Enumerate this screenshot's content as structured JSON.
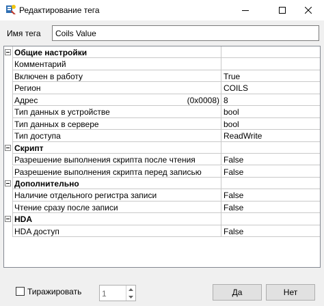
{
  "window": {
    "title": "Редактирование тега",
    "icon": "app-icon",
    "controls": [
      "minimize-icon",
      "maximize-icon",
      "close-icon"
    ]
  },
  "tag_name": {
    "label": "Имя тега",
    "value": "Coils Value"
  },
  "grid": {
    "rows": [
      {
        "type": "category",
        "name": "Общие настройки",
        "value": ""
      },
      {
        "type": "property",
        "name": "Комментарий",
        "value": ""
      },
      {
        "type": "property",
        "name": "Включен в работу",
        "value": "True"
      },
      {
        "type": "property",
        "name": "Регион",
        "value": "COILS"
      },
      {
        "type": "property",
        "name": "Адрес",
        "extra": "(0x0008)",
        "value": "8"
      },
      {
        "type": "property",
        "name": "Тип данных в устройстве",
        "value": "bool"
      },
      {
        "type": "property",
        "name": "Тип данных в сервере",
        "value": "bool"
      },
      {
        "type": "property",
        "name": "Тип доступа",
        "value": "ReadWrite"
      },
      {
        "type": "category",
        "name": "Скрипт",
        "value": ""
      },
      {
        "type": "property",
        "name": "Разрешение выполнения скрипта после чтения",
        "value": "False"
      },
      {
        "type": "property",
        "name": "Разрешение выполнения скрипта перед записью",
        "value": "False"
      },
      {
        "type": "category",
        "name": "Дополнительно",
        "value": ""
      },
      {
        "type": "property",
        "name": "Наличие отдельного регистра записи",
        "value": "False"
      },
      {
        "type": "property",
        "name": "Чтение сразу после записи",
        "value": "False"
      },
      {
        "type": "category",
        "name": "HDA",
        "value": ""
      },
      {
        "type": "property",
        "name": "HDA доступ",
        "value": "False"
      }
    ]
  },
  "footer": {
    "replicate_label": "Тиражировать",
    "replicate_checked": false,
    "count_value": "1",
    "ok_label": "Да",
    "cancel_label": "Нет"
  }
}
